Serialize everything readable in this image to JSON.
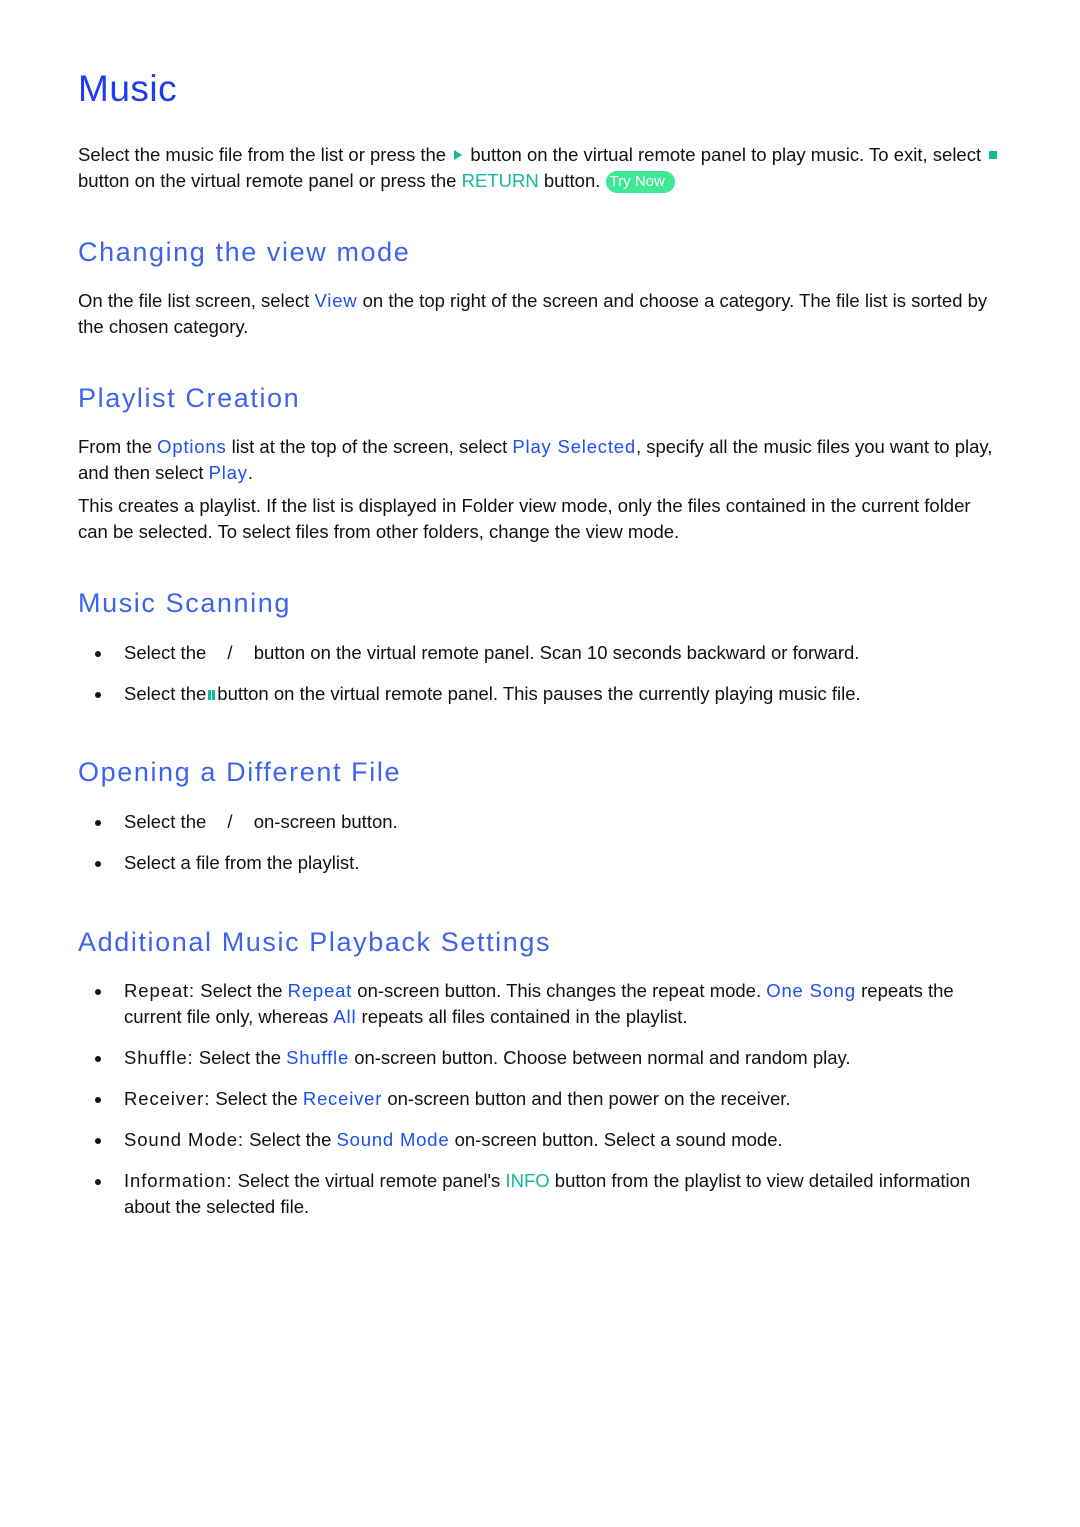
{
  "page_title": "Music",
  "intro": {
    "t1": "Select the music file from the list or press the",
    "play_icon": "play-icon",
    "t2": "button on the virtual remote panel to play music. To exit, select",
    "stop_icon": "stop-icon",
    "t3": "button on the virtual remote panel or press the",
    "return_key": "RETURN",
    "t4": "button.",
    "try_now": "Try Now"
  },
  "sections": {
    "view_mode": {
      "heading": "Changing the view mode",
      "t1": "On the file list screen, select",
      "view": "View",
      "t2": "on the top right of the screen and choose a category. The file list is sorted by the chosen category."
    },
    "playlist": {
      "heading": "Playlist Creation",
      "p1_t1": "From the",
      "options": "Options",
      "p1_t2": "list at the top of the screen, select",
      "play_selected": "Play Selected",
      "p1_t3": ", specify all the music files you want to play, and then select",
      "play": "Play",
      "p1_t4": ".",
      "p2": "This creates a playlist. If the list is displayed in Folder view mode, only the files contained in the current folder can be selected. To select files from other folders, change the view mode."
    },
    "scanning": {
      "heading": "Music Scanning",
      "items": [
        {
          "t1": "Select the",
          "sep": "/",
          "t2": "button on the virtual remote panel. Scan 10 seconds backward or forward."
        },
        {
          "t1": "Select the",
          "t2": "button on the virtual remote panel. This pauses the currently playing music file."
        }
      ]
    },
    "different_file": {
      "heading": "Opening a Different File",
      "items": [
        {
          "t1": "Select the",
          "sep": "/",
          "t2": "on-screen button."
        },
        {
          "t1": "Select a file from the playlist."
        }
      ]
    },
    "additional": {
      "heading": "Additional Music Playback Settings",
      "repeat": {
        "term": "Repeat:",
        "t1": "Select the",
        "btn": "Repeat",
        "t2": "on-screen button. This changes the repeat mode.",
        "one_song": "One Song",
        "t3": "repeats the current file only, whereas",
        "all": "All",
        "t4": "repeats all files contained in the playlist."
      },
      "shuffle": {
        "term": "Shuffle:",
        "t1": "Select the",
        "btn": "Shuffle",
        "t2": "on-screen button. Choose between normal and random play."
      },
      "receiver": {
        "term": "Receiver:",
        "t1": "Select the",
        "btn": "Receiver",
        "t2": "on-screen button and then power on the receiver."
      },
      "sound_mode": {
        "term": "Sound Mode:",
        "t1": "Select the",
        "btn": "Sound Mode",
        "t2": "on-screen button. Select a sound mode."
      },
      "information": {
        "term": "Information:",
        "t1": "Select the virtual remote panel's",
        "btn": "INFO",
        "t2": "button from the playlist to view detailed information about the selected file."
      }
    }
  },
  "colors": {
    "title": "#1f3cf2",
    "heading": "#3e64ee",
    "link": "#1c4ff0",
    "key": "#12b99a",
    "try_now_bg": "#3ee894"
  }
}
